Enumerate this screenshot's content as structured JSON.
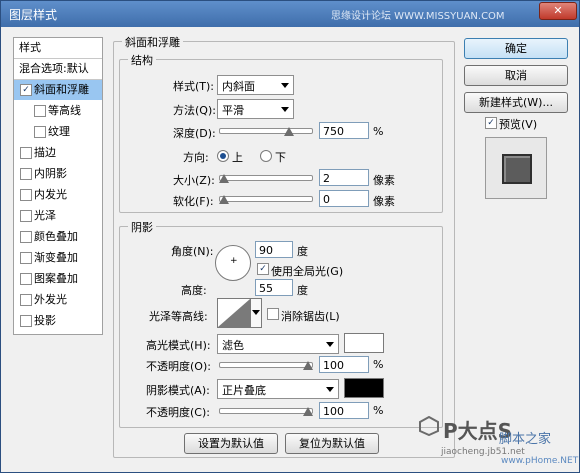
{
  "window": {
    "title": "图层样式",
    "watermark_top": "思缘设计论坛 WWW.MISSYUAN.COM",
    "close": "✕"
  },
  "left": {
    "header": "样式",
    "blend": "混合选项:默认",
    "items": [
      {
        "label": "斜面和浮雕",
        "checked": "✓",
        "selected": true
      },
      {
        "label": "等高线",
        "checked": "",
        "sub": true
      },
      {
        "label": "纹理",
        "checked": "",
        "sub": true
      },
      {
        "label": "描边",
        "checked": ""
      },
      {
        "label": "内阴影",
        "checked": ""
      },
      {
        "label": "内发光",
        "checked": ""
      },
      {
        "label": "光泽",
        "checked": ""
      },
      {
        "label": "颜色叠加",
        "checked": ""
      },
      {
        "label": "渐变叠加",
        "checked": ""
      },
      {
        "label": "图案叠加",
        "checked": ""
      },
      {
        "label": "外发光",
        "checked": ""
      },
      {
        "label": "投影",
        "checked": ""
      }
    ]
  },
  "bevel": {
    "title": "斜面和浮雕",
    "structure": {
      "title": "结构",
      "style_label": "样式(T):",
      "style_value": "内斜面",
      "technique_label": "方法(Q):",
      "technique_value": "平滑",
      "depth_label": "深度(D):",
      "depth_value": "750",
      "depth_pct": "%",
      "depth_slider": 0.75,
      "direction_label": "方向:",
      "dir_up": "上",
      "dir_down": "下",
      "size_label": "大小(Z):",
      "size_value": "2",
      "size_unit": "像素",
      "size_slider": 0.0,
      "soften_label": "软化(F):",
      "soften_value": "0",
      "soften_unit": "像素",
      "soften_slider": 0.0
    },
    "shading": {
      "title": "阴影",
      "angle_label": "角度(N):",
      "angle_value": "90",
      "angle_unit": "度",
      "global_light": "使用全局光(G)",
      "global_check": "✓",
      "altitude_label": "高度:",
      "altitude_value": "55",
      "altitude_unit": "度",
      "gloss_label": "光泽等高线:",
      "antialias": "消除锯齿(L)",
      "highlight_label": "高光模式(H):",
      "highlight_value": "滤色",
      "hl_opacity_label": "不透明度(O):",
      "hl_opacity_value": "100",
      "hl_opacity_pct": "%",
      "shadow_label": "阴影模式(A):",
      "shadow_value": "正片叠底",
      "sh_opacity_label": "不透明度(C):",
      "sh_opacity_value": "100",
      "sh_opacity_pct": "%",
      "highlight_color": "#ffffff",
      "shadow_color": "#000000"
    },
    "default_btn": "设置为默认值",
    "reset_btn": "复位为默认值"
  },
  "buttons": {
    "ok": "确定",
    "cancel": "取消",
    "new_style": "新建样式(W)...",
    "preview": "预览(V)",
    "preview_check": "✓"
  },
  "watermark": {
    "logo": "P大点S",
    "site1": "脚本之家",
    "site2": "jiaocheng.jb51.net",
    "site3": "www.pHome.NET"
  }
}
